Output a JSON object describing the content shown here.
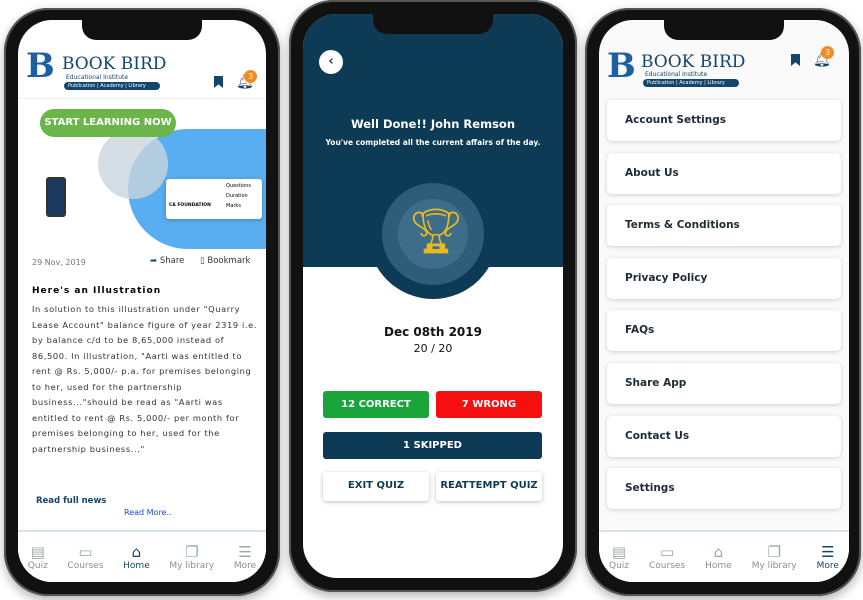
{
  "colors": {
    "navy": "#0d3a55",
    "green": "#1aa53a",
    "red": "#f50f0f",
    "orange": "#f58a1f",
    "link": "#1a4bd6"
  },
  "brand": {
    "name": "BOOK BIRD",
    "subtitle": "Educational Institute",
    "tagline": "Publication | Academy | Library"
  },
  "phone1": {
    "notifications": "3",
    "banner": {
      "cta": "START LEARNING NOW",
      "card_brand": "CA FOUNDATION",
      "card_items": [
        "Questions",
        "Duration",
        "Marks"
      ]
    },
    "date": "29 Nov, 2019",
    "share": "Share",
    "bookmark": "Bookmark",
    "heading": "Here's an Illustration",
    "body": "In solution to this illustration under \"Quarry Lease Account\" balance figure of year 2319 i.e. by balance c/d to be 8,65,000 instead of 86,500. In illustration, \"Aarti was entitled to rent @ Rs. 5,000/- p.a. for premises belonging to her, used for the partnership business...\"should be read as \"Aarti was entitled to rent @ Rs. 5,000/- per month for premises belonging to her, used for the partnership business...\"",
    "read_full": "Read full news",
    "read_more": "Read More..",
    "nav": [
      {
        "label": "Quiz",
        "icon": "quiz-icon"
      },
      {
        "label": "Courses",
        "icon": "courses-icon"
      },
      {
        "label": "Home",
        "icon": "home-icon",
        "active": true
      },
      {
        "label": "My library",
        "icon": "library-icon"
      },
      {
        "label": "More",
        "icon": "menu-icon"
      }
    ]
  },
  "phone2": {
    "title": "Well Done!! John Remson",
    "subtitle": "You've completed all the current affairs of the day.",
    "date": "Dec 08th 2019",
    "score": "20 / 20",
    "correct": "12 CORRECT",
    "wrong": "7 WRONG",
    "skipped": "1 SKIPPED",
    "exit": "EXIT QUIZ",
    "reattempt": "REATTEMPT QUIZ"
  },
  "phone3": {
    "notifications": "3",
    "menu": [
      "Account Settings",
      "About Us",
      "Terms & Conditions",
      "Privacy Policy",
      "FAQs",
      "Share App",
      "Contact Us",
      "Settings"
    ],
    "nav": [
      {
        "label": "Quiz",
        "icon": "quiz-icon"
      },
      {
        "label": "Courses",
        "icon": "courses-icon"
      },
      {
        "label": "Home",
        "icon": "home-icon"
      },
      {
        "label": "My library",
        "icon": "library-icon"
      },
      {
        "label": "More",
        "icon": "menu-icon",
        "active": true
      }
    ]
  }
}
